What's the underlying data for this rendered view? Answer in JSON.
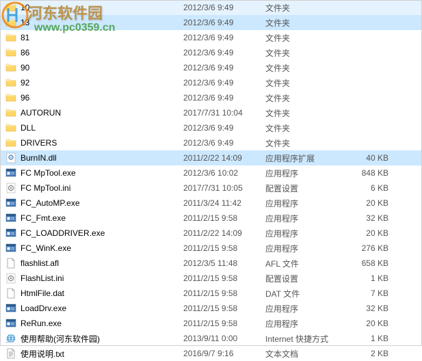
{
  "watermark": {
    "title": "河东软件园",
    "url": "www.pc0359.cn"
  },
  "icons": {
    "folder": "folder",
    "dll": "dll",
    "exe": "exe",
    "ini": "ini",
    "afl": "afl",
    "dat": "dat",
    "url": "url",
    "txt": "txt"
  },
  "rows": [
    {
      "name": "10",
      "date": "2012/3/6 9:49",
      "type": "文件夹",
      "size": "",
      "icon": "folder",
      "sel": false
    },
    {
      "name": "13",
      "date": "2012/3/6 9:49",
      "type": "文件夹",
      "size": "",
      "icon": "folder",
      "sel": true
    },
    {
      "name": "81",
      "date": "2012/3/6 9:49",
      "type": "文件夹",
      "size": "",
      "icon": "folder",
      "sel": false
    },
    {
      "name": "86",
      "date": "2012/3/6 9:49",
      "type": "文件夹",
      "size": "",
      "icon": "folder",
      "sel": false
    },
    {
      "name": "90",
      "date": "2012/3/6 9:49",
      "type": "文件夹",
      "size": "",
      "icon": "folder",
      "sel": false
    },
    {
      "name": "92",
      "date": "2012/3/6 9:49",
      "type": "文件夹",
      "size": "",
      "icon": "folder",
      "sel": false
    },
    {
      "name": "96",
      "date": "2012/3/6 9:49",
      "type": "文件夹",
      "size": "",
      "icon": "folder",
      "sel": false
    },
    {
      "name": "AUTORUN",
      "date": "2017/7/31 10:04",
      "type": "文件夹",
      "size": "",
      "icon": "folder",
      "sel": false
    },
    {
      "name": "DLL",
      "date": "2012/3/6 9:49",
      "type": "文件夹",
      "size": "",
      "icon": "folder",
      "sel": false
    },
    {
      "name": "DRIVERS",
      "date": "2012/3/6 9:49",
      "type": "文件夹",
      "size": "",
      "icon": "folder",
      "sel": false
    },
    {
      "name": "BurnIN.dll",
      "date": "2011/2/22 14:09",
      "type": "应用程序扩展",
      "size": "40 KB",
      "icon": "dll",
      "sel": true
    },
    {
      "name": "FC MpTool.exe",
      "date": "2012/3/6 10:02",
      "type": "应用程序",
      "size": "848 KB",
      "icon": "exe",
      "sel": false
    },
    {
      "name": "FC MpTool.ini",
      "date": "2017/7/31 10:05",
      "type": "配置设置",
      "size": "6 KB",
      "icon": "ini",
      "sel": false
    },
    {
      "name": "FC_AutoMP.exe",
      "date": "2011/3/24 11:42",
      "type": "应用程序",
      "size": "20 KB",
      "icon": "exe",
      "sel": false
    },
    {
      "name": "FC_Fmt.exe",
      "date": "2011/2/15 9:58",
      "type": "应用程序",
      "size": "32 KB",
      "icon": "exe",
      "sel": false
    },
    {
      "name": "FC_LOADDRIVER.exe",
      "date": "2011/2/22 14:09",
      "type": "应用程序",
      "size": "20 KB",
      "icon": "exe",
      "sel": false
    },
    {
      "name": "FC_WinK.exe",
      "date": "2011/2/15 9:58",
      "type": "应用程序",
      "size": "276 KB",
      "icon": "exe",
      "sel": false
    },
    {
      "name": "flashlist.afl",
      "date": "2012/3/5 11:48",
      "type": "AFL 文件",
      "size": "658 KB",
      "icon": "afl",
      "sel": false
    },
    {
      "name": "FlashList.ini",
      "date": "2011/2/15 9:58",
      "type": "配置设置",
      "size": "1 KB",
      "icon": "ini",
      "sel": false
    },
    {
      "name": "HtmlFile.dat",
      "date": "2011/2/15 9:58",
      "type": "DAT 文件",
      "size": "7 KB",
      "icon": "dat",
      "sel": false
    },
    {
      "name": "LoadDrv.exe",
      "date": "2011/2/15 9:58",
      "type": "应用程序",
      "size": "32 KB",
      "icon": "exe",
      "sel": false
    },
    {
      "name": "ReRun.exe",
      "date": "2011/2/15 9:58",
      "type": "应用程序",
      "size": "20 KB",
      "icon": "exe",
      "sel": false
    },
    {
      "name": "使用帮助(河东软件园)",
      "date": "2013/9/11 0:00",
      "type": "Internet 快捷方式",
      "size": "1 KB",
      "icon": "url",
      "sel": false
    },
    {
      "name": "使用说明.txt",
      "date": "2016/9/7 9:16",
      "type": "文本文档",
      "size": "2 KB",
      "icon": "txt",
      "sel": false
    }
  ]
}
